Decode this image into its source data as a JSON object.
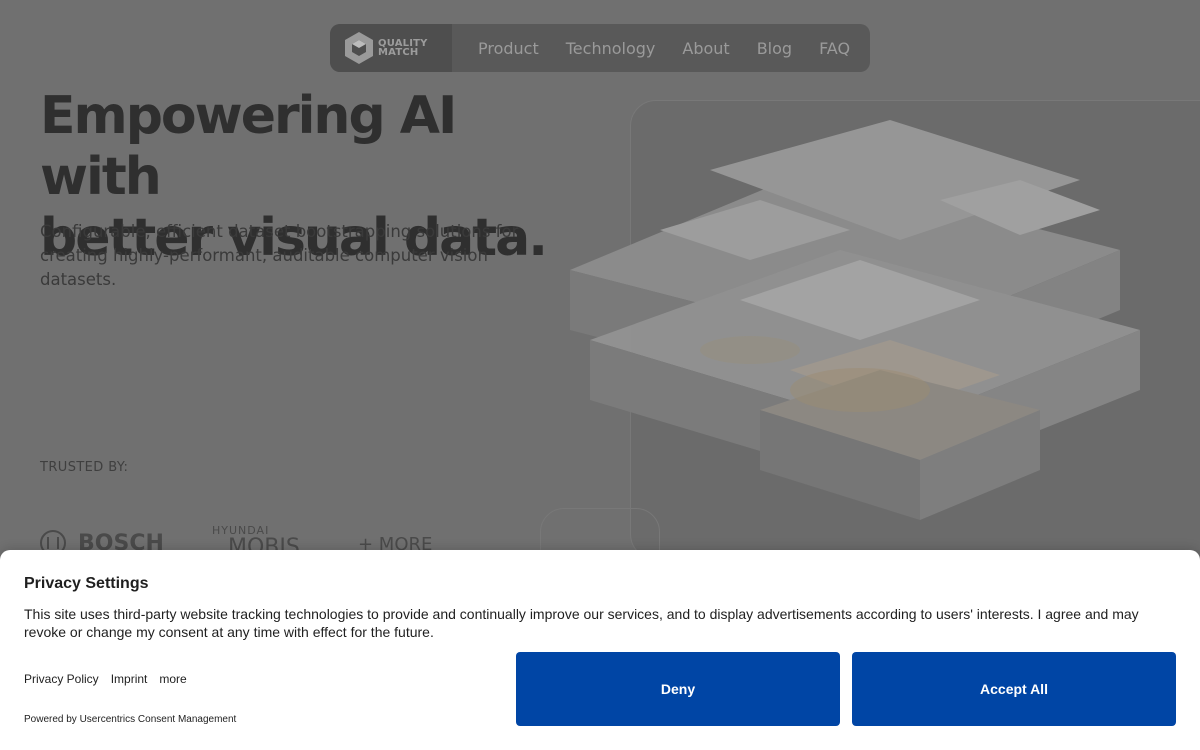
{
  "nav": {
    "logo_line1": "QUALITY",
    "logo_line2": "MATCH",
    "links": [
      "Product",
      "Technology",
      "About",
      "Blog",
      "FAQ"
    ]
  },
  "hero": {
    "title_line1": "Empowering AI with",
    "title_line2": "better visual data.",
    "subtitle": "Configurable, efficient dataset bootstrapping solutions for creating highly-performant, auditable computer vision datasets."
  },
  "trusted": {
    "label": "TRUSTED BY:",
    "logos": {
      "bosch": "BOSCH",
      "mobis_top": "HYUNDAI",
      "mobis_bottom": "MOBIS",
      "more": "+ MORE"
    }
  },
  "consent": {
    "title": "Privacy Settings",
    "text": "This site uses third-party website tracking technologies to provide and continually improve our services, and to display advertisements according to users' interests. I agree and may revoke or change my consent at any time with effect for the future.",
    "links": [
      "Privacy Policy",
      "Imprint",
      "more"
    ],
    "powered_by": "Powered by Usercentrics Consent Management",
    "deny_label": "Deny",
    "accept_label": "Accept All"
  },
  "colors": {
    "overlay_background": "#707070",
    "consent_button": "#0045a5",
    "consent_background": "#ffffff"
  },
  "icons": [
    "quality-match-logo-icon",
    "bosch-logo-icon"
  ]
}
